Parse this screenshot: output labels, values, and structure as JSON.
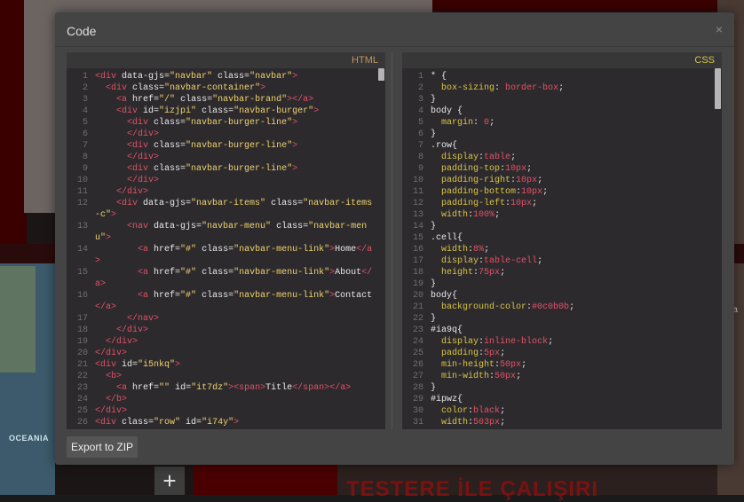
{
  "modal": {
    "title": "Code",
    "close_glyph": "×",
    "export_label": "Export to ZIP"
  },
  "html_panel": {
    "label": "HTML",
    "lines": [
      {
        "n": "1",
        "t": "<div data-gjs=\"navbar\" class=\"navbar\">"
      },
      {
        "n": "2",
        "t": "  <div class=\"navbar-container\">"
      },
      {
        "n": "3",
        "t": "    <a href=\"/\" class=\"navbar-brand\"></a>"
      },
      {
        "n": "4",
        "t": "    <div id=\"izjpi\" class=\"navbar-burger\">"
      },
      {
        "n": "5",
        "t": "      <div class=\"navbar-burger-line\">"
      },
      {
        "n": "6",
        "t": "      </div>"
      },
      {
        "n": "7",
        "t": "      <div class=\"navbar-burger-line\">"
      },
      {
        "n": "8",
        "t": "      </div>"
      },
      {
        "n": "9",
        "t": "      <div class=\"navbar-burger-line\">"
      },
      {
        "n": "10",
        "t": "      </div>"
      },
      {
        "n": "11",
        "t": "    </div>"
      },
      {
        "n": "12",
        "t": "    <div data-gjs=\"navbar-items\" class=\"navbar-items-c\">"
      },
      {
        "n": "13",
        "t": "      <nav data-gjs=\"navbar-menu\" class=\"navbar-menu\">"
      },
      {
        "n": "14",
        "t": "        <a href=\"#\" class=\"navbar-menu-link\">Home</a>"
      },
      {
        "n": "15",
        "t": "        <a href=\"#\" class=\"navbar-menu-link\">About</a>"
      },
      {
        "n": "16",
        "t": "        <a href=\"#\" class=\"navbar-menu-link\">Contact</a>"
      },
      {
        "n": "17",
        "t": "      </nav>"
      },
      {
        "n": "18",
        "t": "    </div>"
      },
      {
        "n": "19",
        "t": "  </div>"
      },
      {
        "n": "20",
        "t": "</div>"
      },
      {
        "n": "21",
        "t": "<div id=\"i5nkq\">"
      },
      {
        "n": "22",
        "t": "  <b>"
      },
      {
        "n": "23",
        "t": "    <a href=\"\" id=\"it7dz\"><span>Title</span></a>"
      },
      {
        "n": "24",
        "t": "  </b>"
      },
      {
        "n": "25",
        "t": "</div>"
      },
      {
        "n": "26",
        "t": "<div class=\"row\" id=\"i74y\">"
      }
    ]
  },
  "css_panel": {
    "label": "CSS",
    "lines": [
      {
        "n": "1",
        "t": "* {"
      },
      {
        "n": "2",
        "t": "  box-sizing: border-box;"
      },
      {
        "n": "3",
        "t": "}"
      },
      {
        "n": "4",
        "t": "body {"
      },
      {
        "n": "5",
        "t": "  margin: 0;"
      },
      {
        "n": "6",
        "t": "}"
      },
      {
        "n": "7",
        "t": ".row{"
      },
      {
        "n": "8",
        "t": "  display:table;"
      },
      {
        "n": "9",
        "t": "  padding-top:10px;"
      },
      {
        "n": "10",
        "t": "  padding-right:10px;"
      },
      {
        "n": "11",
        "t": "  padding-bottom:10px;"
      },
      {
        "n": "12",
        "t": "  padding-left:10px;"
      },
      {
        "n": "13",
        "t": "  width:100%;"
      },
      {
        "n": "14",
        "t": "}"
      },
      {
        "n": "15",
        "t": ".cell{"
      },
      {
        "n": "16",
        "t": "  width:8%;"
      },
      {
        "n": "17",
        "t": "  display:table-cell;"
      },
      {
        "n": "18",
        "t": "  height:75px;"
      },
      {
        "n": "19",
        "t": "}"
      },
      {
        "n": "20",
        "t": "body{"
      },
      {
        "n": "21",
        "t": "  background-color:#0c0b0b;"
      },
      {
        "n": "22",
        "t": "}"
      },
      {
        "n": "23",
        "t": "#ia9q{"
      },
      {
        "n": "24",
        "t": "  display:inline-block;"
      },
      {
        "n": "25",
        "t": "  padding:5px;"
      },
      {
        "n": "26",
        "t": "  min-height:50px;"
      },
      {
        "n": "27",
        "t": "  min-width:50px;"
      },
      {
        "n": "28",
        "t": "}"
      },
      {
        "n": "29",
        "t": "#ipwz{"
      },
      {
        "n": "30",
        "t": "  color:black;"
      },
      {
        "n": "31",
        "t": "  width:503px;"
      }
    ]
  },
  "background": {
    "map_label": "OCEANIA",
    "zoom_glyph": "+",
    "banner_text": "TESTERE İLE ÇALIŞIRI",
    "side_text": "ra"
  },
  "colors": {
    "html_label": "#c4925a",
    "css_label": "#d8c445",
    "tag": "#e05266",
    "string": "#f0d36b"
  }
}
